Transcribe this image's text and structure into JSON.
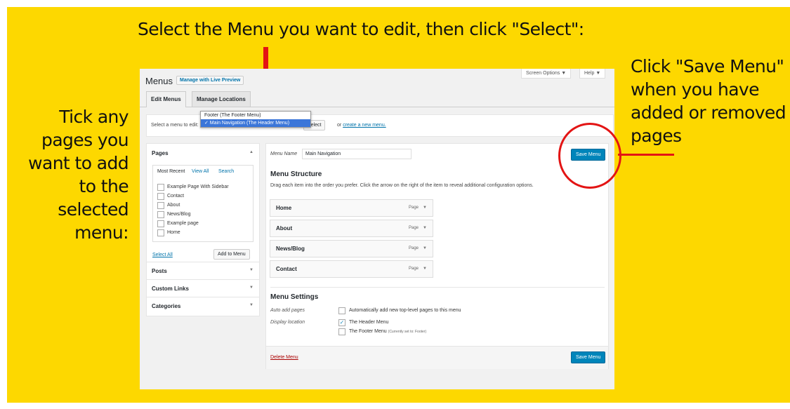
{
  "annotations": {
    "top": "Select the Menu you want to edit, then click \"Select\":",
    "left": "Tick any pages you want to add to the selected menu:",
    "right": "Click \"Save Menu\" when you have added or removed pages"
  },
  "colors": {
    "banner": "#fdd800",
    "annotation_red": "#e31414",
    "wp_blue": "#0085ba",
    "link_blue": "#0073aa"
  },
  "header": {
    "title": "Menus",
    "live_preview": "Manage with Live Preview",
    "screen_options": "Screen Options ▼",
    "help": "Help ▼",
    "tabs": [
      "Edit Menus",
      "Manage Locations"
    ]
  },
  "select_bar": {
    "label": "Select a menu to edit:",
    "options": [
      "Footer (The Footer Menu)",
      "Main Navigation (The Header Menu)"
    ],
    "selected": "✓ Main Navigation (The Header Menu)",
    "select_button": "Select",
    "or_text": "or",
    "create_link": "create a new menu."
  },
  "pages_panel": {
    "title": "Pages",
    "subtabs": [
      "Most Recent",
      "View All",
      "Search"
    ],
    "items": [
      "Example Page With Sidebar",
      "Contact",
      "About",
      "News/Blog",
      "Example page",
      "Home"
    ],
    "select_all": "Select All",
    "add_button": "Add to Menu",
    "sections": [
      "Posts",
      "Custom Links",
      "Categories"
    ]
  },
  "menu_editor": {
    "name_label": "Menu Name",
    "name_value": "Main Navigation",
    "save_button": "Save Menu",
    "structure_title": "Menu Structure",
    "structure_desc": "Drag each item into the order you prefer. Click the arrow on the right of the item to reveal additional configuration options.",
    "items": [
      {
        "title": "Home",
        "type": "Page"
      },
      {
        "title": "About",
        "type": "Page"
      },
      {
        "title": "News/Blog",
        "type": "Page"
      },
      {
        "title": "Contact",
        "type": "Page"
      }
    ],
    "settings_title": "Menu Settings",
    "auto_add_label": "Auto add pages",
    "auto_add_text": "Automatically add new top-level pages to this menu",
    "display_label": "Display location",
    "header_menu": "The Header Menu",
    "footer_menu": "The Footer Menu",
    "footer_note": "(Currently set to: Footer)",
    "delete_link": "Delete Menu"
  }
}
